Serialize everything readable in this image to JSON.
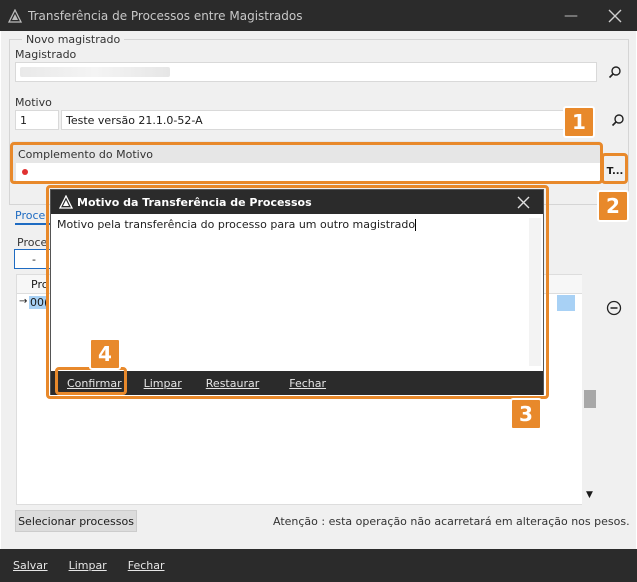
{
  "window": {
    "title": "Transferência de Processos entre Magistrados"
  },
  "form": {
    "group_title": "Novo magistrado",
    "magistrado_label": "Magistrado",
    "motivo_label": "Motivo",
    "motivo_code": "1",
    "motivo_text": "Teste versão 21.1.0-52-A",
    "complemento_label": "Complemento do Motivo",
    "complemento_btn": "T..."
  },
  "tabs": {
    "active_tab": "Proce",
    "panel_label": "Proce",
    "mini_input_value": "-",
    "column_header": "Pro",
    "row_value": "00("
  },
  "actions": {
    "select_processes": "Selecionar processos",
    "warning": "Atenção : esta operação não acarretará em alteração nos pesos."
  },
  "bottom": {
    "salvar": "Salvar",
    "limpar": "Limpar",
    "fechar": "Fechar"
  },
  "popup": {
    "title": "Motivo da Transferência de Processos",
    "text": "Motivo pela transferência do processo para um outro magistrado",
    "confirmar": "Confirmar",
    "limpar": "Limpar",
    "restaurar": "Restaurar",
    "fechar": "Fechar"
  },
  "callouts": [
    "1",
    "2",
    "3",
    "4"
  ],
  "colors": {
    "callout": "#e8892b",
    "titlebar": "#2b2b2b",
    "required_dot": "#e03131"
  }
}
